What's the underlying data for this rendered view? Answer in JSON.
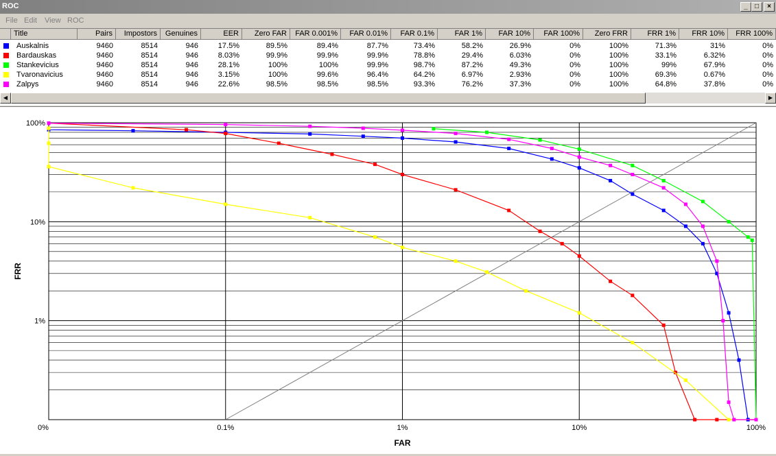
{
  "window": {
    "title": "ROC"
  },
  "menu": [
    "File",
    "Edit",
    "View",
    "ROC"
  ],
  "table": {
    "columns": [
      "Title",
      "Pairs",
      "Impostors",
      "Genuines",
      "EER",
      "Zero FAR",
      "FAR 0.001%",
      "FAR 0.01%",
      "FAR 0.1%",
      "FAR 1%",
      "FAR 10%",
      "FAR 100%",
      "Zero FRR",
      "FRR 1%",
      "FRR 10%",
      "FRR 100%"
    ],
    "rows": [
      {
        "color": "#0000ff",
        "cells": [
          "Auskalnis",
          "9460",
          "8514",
          "946",
          "17.5%",
          "89.5%",
          "89.4%",
          "87.7%",
          "73.4%",
          "58.2%",
          "26.9%",
          "0%",
          "100%",
          "71.3%",
          "31%",
          "0%"
        ]
      },
      {
        "color": "#ff0000",
        "cells": [
          "Bardauskas",
          "9460",
          "8514",
          "946",
          "8.03%",
          "99.9%",
          "99.9%",
          "99.9%",
          "78.8%",
          "29.4%",
          "6.03%",
          "0%",
          "100%",
          "33.1%",
          "6.32%",
          "0%"
        ]
      },
      {
        "color": "#00ff00",
        "cells": [
          "Stankevicius",
          "9460",
          "8514",
          "946",
          "28.1%",
          "100%",
          "100%",
          "99.9%",
          "98.7%",
          "87.2%",
          "49.3%",
          "0%",
          "100%",
          "99%",
          "67.9%",
          "0%"
        ]
      },
      {
        "color": "#ffff00",
        "cells": [
          "Tvaronavicius",
          "9460",
          "8514",
          "946",
          "3.15%",
          "100%",
          "99.6%",
          "96.4%",
          "64.2%",
          "6.97%",
          "2.93%",
          "0%",
          "100%",
          "69.3%",
          "0.67%",
          "0%"
        ]
      },
      {
        "color": "#ff00ff",
        "cells": [
          "Zalpys",
          "9460",
          "8514",
          "946",
          "22.6%",
          "98.5%",
          "98.5%",
          "98.5%",
          "93.3%",
          "76.2%",
          "37.3%",
          "0%",
          "100%",
          "64.8%",
          "37.8%",
          "0%"
        ]
      }
    ]
  },
  "chart_data": {
    "type": "line",
    "xlabel": "FAR",
    "ylabel": "FRR",
    "x_ticks": [
      "0%",
      "0.1%",
      "1%",
      "10%",
      "100%"
    ],
    "y_ticks": [
      "100%",
      "10%",
      "1%"
    ],
    "grid": true,
    "diagonal": true,
    "series": [
      {
        "name": "Auskalnis",
        "color": "#0000ff",
        "points": [
          [
            0,
            87
          ],
          [
            1e-05,
            85
          ],
          [
            0.0003,
            83
          ],
          [
            0.001,
            80
          ],
          [
            0.003,
            77
          ],
          [
            0.006,
            73
          ],
          [
            0.01,
            70
          ],
          [
            0.02,
            64
          ],
          [
            0.04,
            55
          ],
          [
            0.07,
            43
          ],
          [
            0.1,
            35
          ],
          [
            0.15,
            26
          ],
          [
            0.2,
            19
          ],
          [
            0.3,
            13
          ],
          [
            0.4,
            9
          ],
          [
            0.5,
            6
          ],
          [
            0.6,
            3
          ],
          [
            0.7,
            1.2
          ],
          [
            0.8,
            0.4
          ],
          [
            0.9,
            0.01
          ],
          [
            1,
            0
          ]
        ]
      },
      {
        "name": "Bardauskas",
        "color": "#ff0000",
        "points": [
          [
            0,
            99
          ],
          [
            0.0001,
            99
          ],
          [
            0.0006,
            85
          ],
          [
            0.001,
            78
          ],
          [
            0.002,
            62
          ],
          [
            0.004,
            48
          ],
          [
            0.007,
            38
          ],
          [
            0.01,
            30
          ],
          [
            0.02,
            21
          ],
          [
            0.04,
            13
          ],
          [
            0.06,
            8
          ],
          [
            0.08,
            6
          ],
          [
            0.1,
            4.5
          ],
          [
            0.15,
            2.5
          ],
          [
            0.2,
            1.8
          ],
          [
            0.3,
            0.9
          ],
          [
            0.35,
            0.3
          ],
          [
            0.45,
            0.05
          ],
          [
            0.6,
            0.01
          ],
          [
            1,
            0
          ]
        ]
      },
      {
        "name": "Stankevicius",
        "color": "#00ff00",
        "points": [
          [
            0.015,
            87
          ],
          [
            0.03,
            80
          ],
          [
            0.06,
            67
          ],
          [
            0.1,
            54
          ],
          [
            0.2,
            37
          ],
          [
            0.3,
            26
          ],
          [
            0.5,
            16
          ],
          [
            0.7,
            10
          ],
          [
            0.9,
            7
          ],
          [
            0.95,
            6.5
          ],
          [
            1,
            0
          ]
        ]
      },
      {
        "name": "Tvaronavicius",
        "color": "#ffff00",
        "points": [
          [
            0,
            88
          ],
          [
            3e-05,
            62
          ],
          [
            0.0001,
            36
          ],
          [
            0.0003,
            22
          ],
          [
            0.001,
            15
          ],
          [
            0.003,
            11
          ],
          [
            0.007,
            7
          ],
          [
            0.01,
            5.5
          ],
          [
            0.02,
            4
          ],
          [
            0.03,
            3.1
          ],
          [
            0.05,
            2
          ],
          [
            0.1,
            1.2
          ],
          [
            0.2,
            0.6
          ],
          [
            0.4,
            0.25
          ],
          [
            0.7,
            0.07
          ],
          [
            1,
            0
          ]
        ]
      },
      {
        "name": "Zalpys",
        "color": "#ff00ff",
        "points": [
          [
            0,
            99
          ],
          [
            0.0001,
            99
          ],
          [
            0.001,
            96
          ],
          [
            0.003,
            92
          ],
          [
            0.006,
            88
          ],
          [
            0.01,
            84
          ],
          [
            0.02,
            78
          ],
          [
            0.04,
            68
          ],
          [
            0.07,
            55
          ],
          [
            0.1,
            45
          ],
          [
            0.15,
            37
          ],
          [
            0.2,
            30
          ],
          [
            0.3,
            22
          ],
          [
            0.4,
            15
          ],
          [
            0.5,
            9
          ],
          [
            0.6,
            4
          ],
          [
            0.65,
            1
          ],
          [
            0.7,
            0.15
          ],
          [
            0.75,
            0.01
          ],
          [
            1,
            0
          ]
        ]
      }
    ]
  }
}
